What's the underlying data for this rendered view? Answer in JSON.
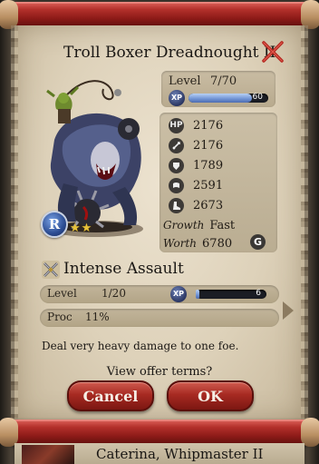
{
  "card": {
    "title": "Troll Boxer Dreadnought II",
    "rank_letter": "R",
    "stars": "★★"
  },
  "level": {
    "label": "Level",
    "value": "7/70",
    "xp_badge": "XP",
    "xp_value": "60",
    "xp_fill_percent": 80
  },
  "stats": {
    "hp": {
      "icon": "HP",
      "value": "2176"
    },
    "attack": {
      "value": "2176"
    },
    "defense": {
      "value": "1789"
    },
    "wisdom": {
      "value": "2591"
    },
    "agility": {
      "value": "2673"
    },
    "growth": {
      "label": "Growth",
      "value": "Fast"
    },
    "worth": {
      "label": "Worth",
      "value": "6780",
      "coin": "G"
    }
  },
  "skill": {
    "name": "Intense Assault",
    "level_label": "Level",
    "level_value": "1/20",
    "xp_badge": "XP",
    "xp_value": "6",
    "xp_fill_percent": 5,
    "proc_label": "Proc",
    "proc_value": "11%",
    "description": "Deal very heavy damage to one foe."
  },
  "dialog": {
    "question": "View offer terms?",
    "cancel_label": "Cancel",
    "ok_label": "OK"
  },
  "next_item": {
    "name": "Caterina, Whipmaster II"
  },
  "colors": {
    "button_red": "#a72a22",
    "parchment": "#ddd1b9",
    "xp_blue": "#6f92d4"
  }
}
